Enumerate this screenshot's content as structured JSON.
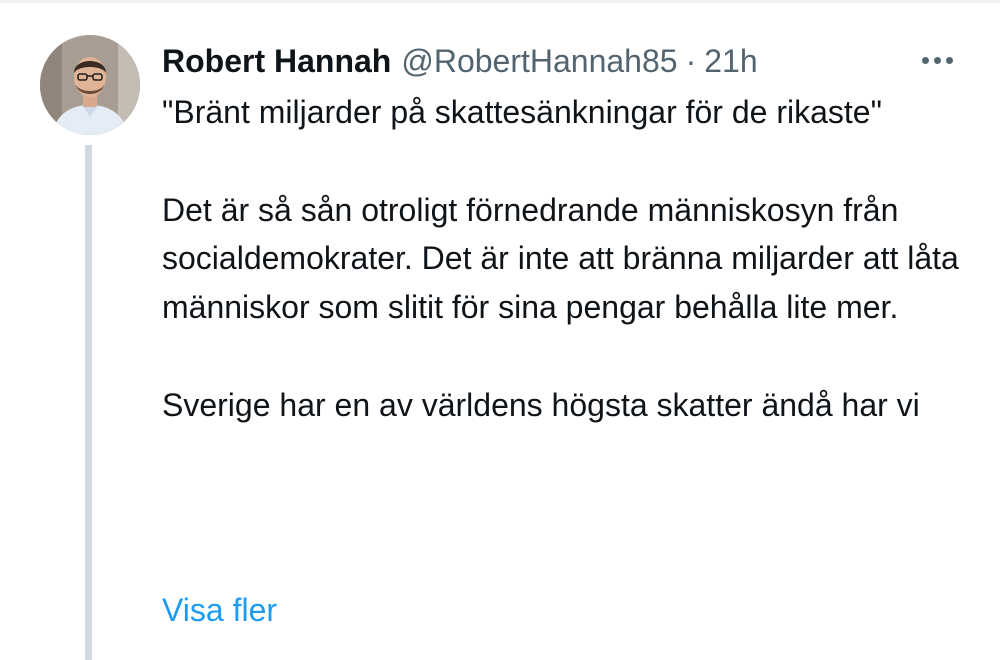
{
  "tweet": {
    "display_name": "Robert Hannah",
    "handle": "@RobertHannah85",
    "separator": "·",
    "time": "21h",
    "more_icon": "more-dots-icon",
    "avatar": "profile-photo",
    "paragraphs": [
      "\"Bränt miljarder på skattesänkningar för de rikaste\"",
      "Det är så sån otroligt förnedrande människosyn från socialdemokrater. Det är inte att bränna miljarder att låta människor som slitit för sina pengar behålla lite mer.",
      "Sverige har en av världens högsta skatter ändå har vi"
    ],
    "show_more": "Visa fler"
  },
  "colors": {
    "text": "#0f1419",
    "secondary": "#536471",
    "link": "#1d9bf0",
    "thread_line": "#cfd9de"
  }
}
